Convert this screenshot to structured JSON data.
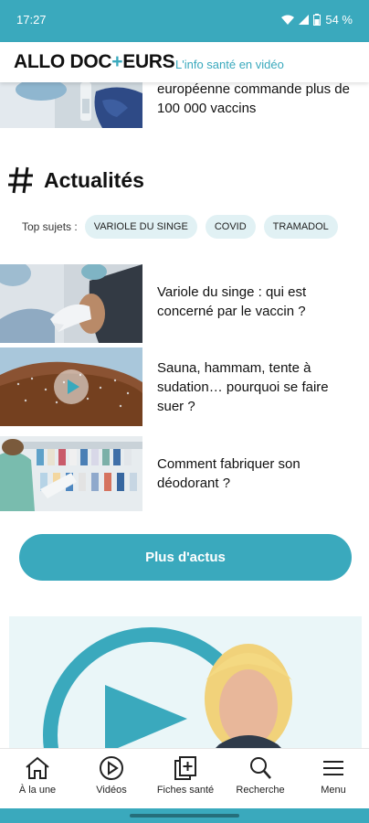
{
  "status_bar": {
    "time": "17:27",
    "battery": "54 %"
  },
  "header": {
    "logo_left": "ALLO DOC",
    "logo_plus": "+",
    "logo_right": "EURS",
    "tagline": "L'info santé en vidéo"
  },
  "top_article": {
    "title": "européenne commande plus de 100 000 vaccins"
  },
  "section": {
    "title": "Actualités"
  },
  "topics": {
    "label": "Top sujets :",
    "chips": [
      "VARIOLE DU SINGE",
      "COVID",
      "TRAMADOL"
    ]
  },
  "articles": [
    {
      "title": "Variole du singe : qui est concerné par le vaccin ?",
      "video": false
    },
    {
      "title": "Sauna, hammam, tente à sudation… pourquoi se faire suer ?",
      "video": true
    },
    {
      "title": "Comment fabriquer son déodorant ?",
      "video": false
    }
  ],
  "more_button": {
    "label": "Plus d'actus"
  },
  "bottom_nav": [
    {
      "label": "À la une",
      "icon": "home-icon"
    },
    {
      "label": "Vidéos",
      "icon": "play-circle-icon"
    },
    {
      "label": "Fiches santé",
      "icon": "health-sheets-icon"
    },
    {
      "label": "Recherche",
      "icon": "search-icon"
    },
    {
      "label": "Menu",
      "icon": "hamburger-menu-icon"
    }
  ],
  "colors": {
    "accent": "#3aa9bd",
    "chip_bg": "#e1f1f4"
  }
}
